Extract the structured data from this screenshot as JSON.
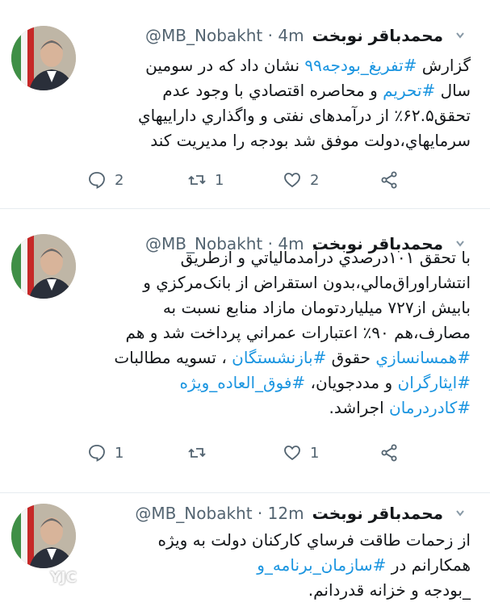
{
  "tweets": [
    {
      "name": "محمدباقر نوبخت",
      "handle": "@MB_Nobakht",
      "time": "4m",
      "lines": [
        [
          {
            "t": "گزارش "
          },
          {
            "t": "#تفريغ_بودجه۹۹",
            "h": true
          },
          {
            "t": " نشان داد كه در سومين"
          }
        ],
        [
          {
            "t": "سال "
          },
          {
            "t": "#تحريم",
            "h": true
          },
          {
            "t": " و محاصره اقتصادي با وجود عدم"
          }
        ],
        [
          {
            "t": "تحقق۶۲.۵٪ از درآمدهای نفتی و واگذاري داراييهاي"
          }
        ],
        [
          {
            "t": "سرمايهاي،دولت موفق شد بودجه را مديريت كند"
          }
        ]
      ],
      "replies": "2",
      "retweets": "1",
      "likes": "2"
    },
    {
      "name": "محمدباقر نوبخت",
      "handle": "@MB_Nobakht",
      "time": "4m",
      "lines": [
        [
          {
            "t": "با تحقق ۱۰۱درصدي درآمدمالياتي و ازطريق"
          }
        ],
        [
          {
            "t": "انتشاراوراق‌مالي،بدون استقراض از بانک‌مرکزي و"
          }
        ],
        [
          {
            "t": "بابيش از۷۲۷ ميليارد‌تومان مازاد منابع نسبت به"
          }
        ],
        [
          {
            "t": "مصارف،هم ۹۰٪ اعتبارات عمراني پرداخت شد و هم"
          }
        ],
        [
          {
            "t": "#همسانسازي",
            "h": true
          },
          {
            "t": " حقوق "
          },
          {
            "t": "#بازنشستگان",
            "h": true
          },
          {
            "t": " ، تسويه مطالبات"
          }
        ],
        [
          {
            "t": "#ايثارگران",
            "h": true
          },
          {
            "t": " و مددجويان، "
          },
          {
            "t": "#فوق_العاده_ويژه",
            "h": true
          }
        ],
        [
          {
            "t": "#كادردرمان",
            "h": true
          },
          {
            "t": " اجراشد."
          }
        ]
      ],
      "replies": "1",
      "retweets": "",
      "likes": "1"
    },
    {
      "name": "محمدباقر نوبخت",
      "handle": "@MB_Nobakht",
      "time": "12m",
      "lines": [
        [
          {
            "t": "از زحمات طاقت فرساي كاركنان دولت به ويژه"
          }
        ],
        [
          {
            "t": "همكارانم در "
          },
          {
            "t": "#سازمان_برنامه_و",
            "h": true
          }
        ],
        [
          {
            "t": "_بودجه  و خزانه قدردانم."
          }
        ]
      ]
    }
  ],
  "watermark": "YJC"
}
